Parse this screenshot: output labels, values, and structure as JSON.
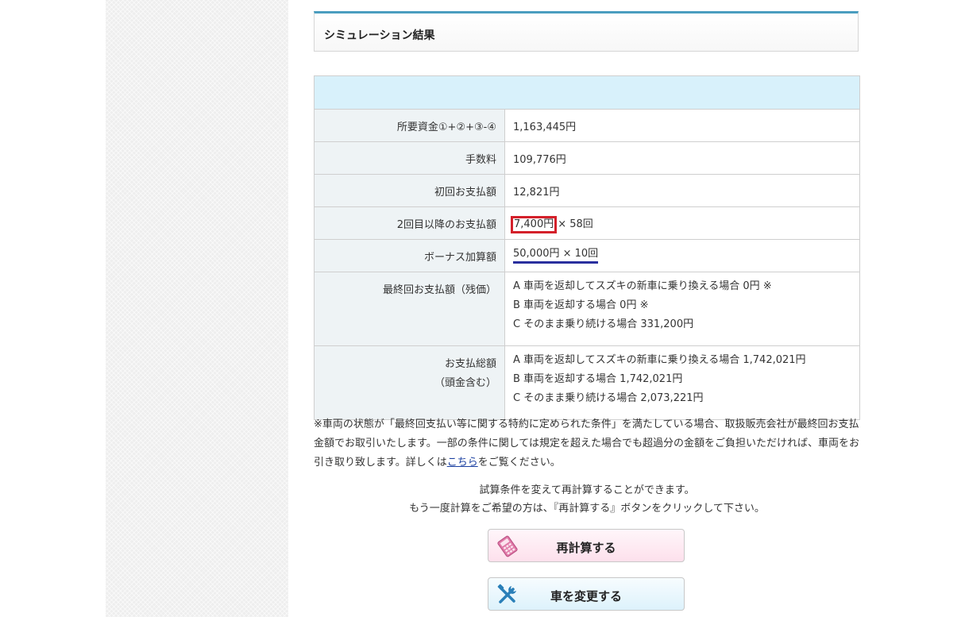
{
  "section": {
    "title": "シミュレーション結果"
  },
  "rows": [
    {
      "label": "所要資金①+②+③-④",
      "value": "1,163,445円"
    },
    {
      "label": "手数料",
      "value": "109,776円"
    },
    {
      "label": "初回お支払額",
      "value": "12,821円"
    },
    {
      "label": "2回目以降のお支払額",
      "value_highlight": "7,400円",
      "value_suffix": "× 58回"
    },
    {
      "label": "ボーナス加算額",
      "value": "50,000円 × 10回"
    }
  ],
  "final_payment": {
    "label": "最終回お支払額（残価）",
    "lines": [
      "A 車両を返却してスズキの新車に乗り換える場合 0円 ※",
      "B 車両を返却する場合 0円 ※",
      "C そのまま乗り続ける場合 331,200円"
    ]
  },
  "total_payment": {
    "label_line1": "お支払総額",
    "label_line2": "（頭金含む）",
    "lines": [
      "A 車両を返却してスズキの新車に乗り換える場合 1,742,021円",
      "B 車両を返却する場合 1,742,021円",
      "C そのまま乗り続ける場合 2,073,221円"
    ]
  },
  "note": {
    "before_link": "※車両の状態が「最終回支払い等に関する特約に定められた条件」を満たしている場合、取扱販売会社が最終回お支払金額でお取引いたします。一部の条件に関しては規定を超えた場合でも超過分の金額をご負担いただければ、車両をお引き取り致します。詳しくは",
    "link": "こちら",
    "after_link": "をご覧ください。"
  },
  "recalc_info": {
    "line1": "試算条件を変えて再計算することができます。",
    "line2": "もう一度計算をご希望の方は、『再計算する』ボタンをクリックして下さい。"
  },
  "buttons": {
    "recalc": {
      "label": "再計算する",
      "icon": "calculator-icon"
    },
    "change_car": {
      "label": "車を変更する",
      "icon": "tools-icon"
    }
  },
  "colors": {
    "accent": "#4a9dbf",
    "table_band": "#d8f1fb",
    "label_bg": "#eef3f5",
    "highlight_box": "#d4202a",
    "underline": "#2a2f9e",
    "link": "#1a3fa0"
  }
}
